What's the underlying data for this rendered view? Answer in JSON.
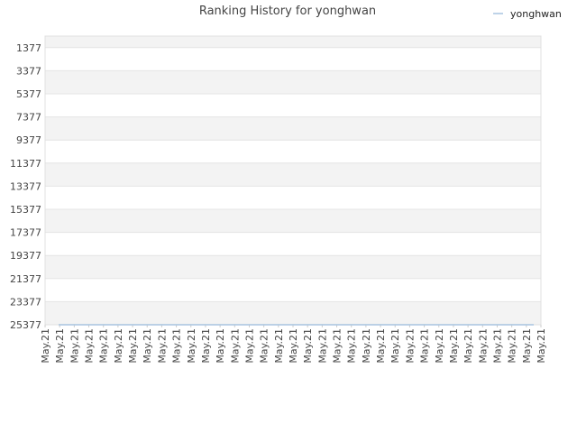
{
  "chart_data": {
    "type": "line",
    "title": "Ranking History for yonghwan",
    "xlabel": "",
    "ylabel": "",
    "y_inverted": true,
    "ylim": [
      377,
      25377
    ],
    "y_ticks": [
      "1377",
      "3377",
      "5377",
      "7377",
      "9377",
      "11377",
      "13377",
      "15377",
      "17377",
      "19377",
      "21377",
      "23377",
      "25377"
    ],
    "y_tick_values": [
      1377,
      3377,
      5377,
      7377,
      9377,
      11377,
      13377,
      15377,
      17377,
      19377,
      21377,
      23377,
      25377
    ],
    "x_ticks": [
      "May.21",
      "May.21",
      "May.21",
      "May.21",
      "May.21",
      "May.21",
      "May.21",
      "May.21",
      "May.21",
      "May.21",
      "May.21",
      "May.21",
      "May.21",
      "May.21",
      "May.21",
      "May.21",
      "May.21",
      "May.21",
      "May.21",
      "May.21",
      "May.21",
      "May.21",
      "May.21",
      "May.21",
      "May.21",
      "May.21",
      "May.21",
      "May.21",
      "May.21",
      "May.21",
      "May.21",
      "May.21",
      "May.21",
      "May.21",
      "May.21"
    ],
    "series": [
      {
        "name": "yonghwan",
        "color": "#a8c4e0",
        "values": [
          25377,
          25377,
          25377,
          25377,
          25377,
          25377,
          25377,
          25377,
          25377,
          25377,
          25377,
          25377,
          25377,
          25377,
          25377,
          25377,
          25377,
          25377,
          25377,
          25377,
          25377,
          25377,
          25377,
          25377,
          25377,
          25377,
          25377,
          25377,
          25377,
          25377,
          25377,
          25377,
          25377,
          25377
        ]
      }
    ],
    "legend_position": "top-right",
    "grid": true,
    "band_colors": [
      "#f3f3f3",
      "#ffffff"
    ],
    "plot_border_color": "#e0e0e0"
  }
}
